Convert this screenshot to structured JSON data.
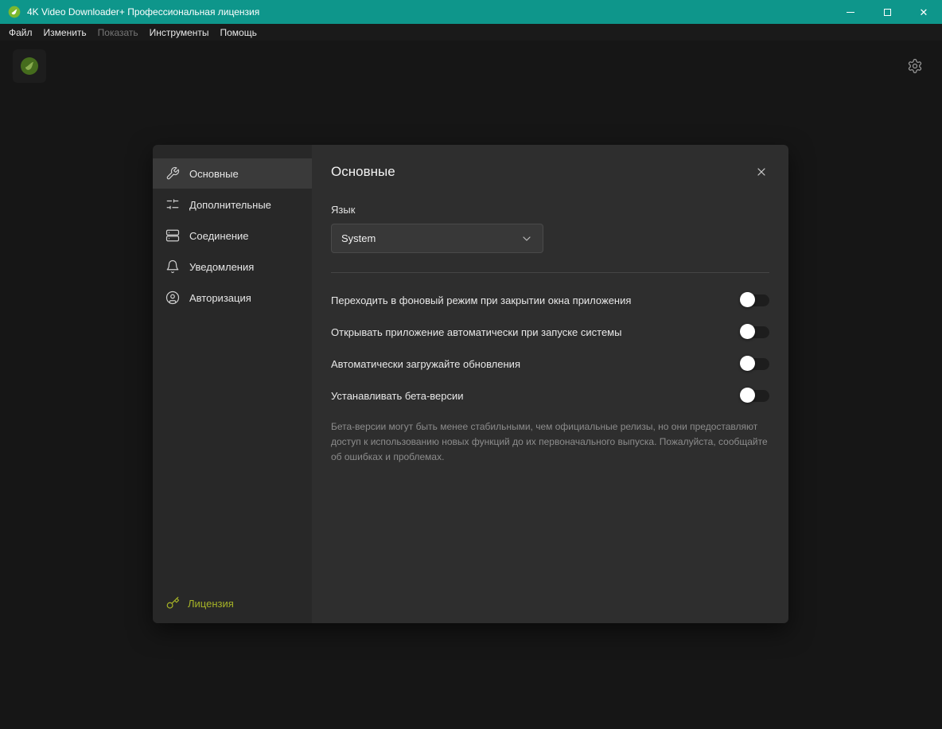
{
  "window": {
    "title": "4K Video Downloader+ Профессиональная лицензия",
    "controls": [
      "minimize",
      "maximize",
      "close"
    ]
  },
  "menubar": {
    "items": [
      {
        "label": "Файл",
        "enabled": true
      },
      {
        "label": "Изменить",
        "enabled": true
      },
      {
        "label": "Показать",
        "enabled": false
      },
      {
        "label": "Инструменты",
        "enabled": true
      },
      {
        "label": "Помощь",
        "enabled": true
      }
    ]
  },
  "dialog": {
    "sidebar": {
      "items": [
        {
          "label": "Основные",
          "icon": "wrench-icon",
          "selected": true
        },
        {
          "label": "Дополнительные",
          "icon": "sliders-icon",
          "selected": false
        },
        {
          "label": "Соединение",
          "icon": "server-icon",
          "selected": false
        },
        {
          "label": "Уведомления",
          "icon": "bell-icon",
          "selected": false
        },
        {
          "label": "Авторизация",
          "icon": "user-circle-icon",
          "selected": false
        }
      ],
      "license": {
        "label": "Лицензия",
        "icon": "key-icon"
      }
    },
    "content": {
      "title": "Основные",
      "close_icon": "close-icon",
      "language": {
        "label": "Язык",
        "value": "System"
      },
      "toggles": [
        {
          "label": "Переходить в фоновый режим при закрытии окна приложения",
          "state": "off"
        },
        {
          "label": "Открывать приложение автоматически при запуске системы",
          "state": "off"
        },
        {
          "label": "Автоматически загружайте обновления",
          "state": "off"
        },
        {
          "label": "Устанавливать бета-версии",
          "state": "off"
        }
      ],
      "beta_note": "Бета-версии могут быть менее стабильными, чем официальные релизы, но они предоставляют доступ к использованию новых функций до их первоначального выпуска. Пожалуйста, сообщайте об ошибках и проблемах."
    }
  },
  "colors": {
    "titlebar": "#0E968B",
    "logo_green": "#7CB82F",
    "license_text": "#A6B327",
    "dialog_sidebar": "#282828",
    "dialog_content": "#2E2E2E"
  },
  "icons": {
    "app": "app-logo-icon",
    "settings": "gear-icon",
    "dropdown": "chevron-down-icon"
  }
}
